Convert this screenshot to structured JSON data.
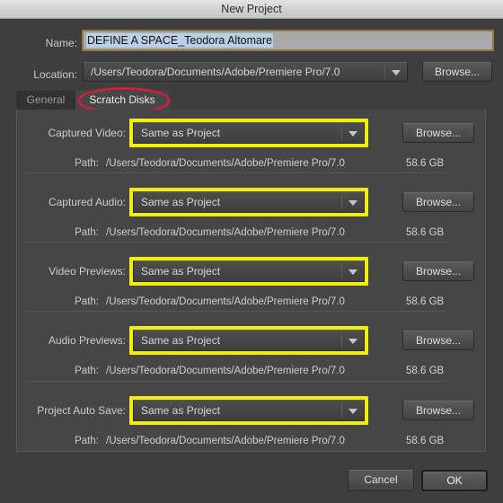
{
  "window": {
    "title": "New Project"
  },
  "form": {
    "name_label": "Name:",
    "name_value": "DEFINE A SPACE_Teodora Altomare",
    "location_label": "Location:",
    "location_value": "/Users/Teodora/Documents/Adobe/Premiere Pro/7.0",
    "location_browse_label": "Browse..."
  },
  "tabs": [
    {
      "label": "General",
      "active": false
    },
    {
      "label": "Scratch Disks",
      "active": true
    }
  ],
  "scratch_rows": [
    {
      "label": "Captured Video:",
      "select_value": "Same as Project",
      "browse_label": "Browse...",
      "path_label": "Path:",
      "path_value": "/Users/Teodora/Documents/Adobe/Premiere Pro/7.0",
      "size": "58.6 GB"
    },
    {
      "label": "Captured Audio:",
      "select_value": "Same as Project",
      "browse_label": "Browse...",
      "path_label": "Path:",
      "path_value": "/Users/Teodora/Documents/Adobe/Premiere Pro/7.0",
      "size": "58.6 GB"
    },
    {
      "label": "Video Previews:",
      "select_value": "Same as Project",
      "browse_label": "Browse...",
      "path_label": "Path:",
      "path_value": "/Users/Teodora/Documents/Adobe/Premiere Pro/7.0",
      "size": "58.6 GB"
    },
    {
      "label": "Audio Previews:",
      "select_value": "Same as Project",
      "browse_label": "Browse...",
      "path_label": "Path:",
      "path_value": "/Users/Teodora/Documents/Adobe/Premiere Pro/7.0",
      "size": "58.6 GB"
    },
    {
      "label": "Project Auto Save:",
      "select_value": "Same as Project",
      "browse_label": "Browse...",
      "path_label": "Path:",
      "path_value": "/Users/Teodora/Documents/Adobe/Premiere Pro/7.0",
      "size": "58.6 GB"
    }
  ],
  "footer": {
    "cancel_label": "Cancel",
    "ok_label": "OK"
  },
  "annotations": {
    "highlight_color": "#f2ee09",
    "ellipse_color": "#c7213c",
    "selection_color": "#b9cfe8"
  },
  "icons": {
    "dropdown": "chevron-down-icon"
  }
}
